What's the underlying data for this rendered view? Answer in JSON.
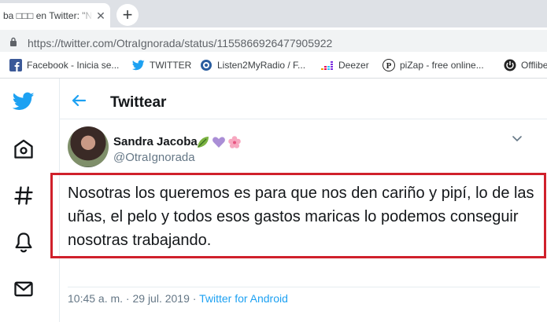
{
  "browser": {
    "tab": {
      "title": "ba □□□ en Twitter: \"N"
    },
    "url": "https://twitter.com/OtraIgnorada/status/1155866926477905922",
    "bookmarks": [
      {
        "label": "Facebook - Inicia se...",
        "icon": "facebook-icon"
      },
      {
        "label": "TWITTER",
        "icon": "twitter-icon"
      },
      {
        "label": "Listen2MyRadio / F...",
        "icon": "radio-icon"
      },
      {
        "label": "Deezer",
        "icon": "deezer-icon"
      },
      {
        "label": "piZap - free online...",
        "icon": "pizap-icon"
      },
      {
        "label": "Offlibe",
        "icon": "power-icon"
      }
    ]
  },
  "twitter": {
    "header_title": "Twittear",
    "author": {
      "name": "Sandra Jacoba",
      "handle": "@OtraIgnorada"
    },
    "tweet_text": "Nosotras los queremos es para que nos den cariño y pipí, lo de las uñas, el pelo y todos esos gastos maricas lo podemos conseguir nosotras trabajando.",
    "timestamp": "10:45 a. m. · 29 jul. 2019 · ",
    "source": "Twitter for Android"
  },
  "colors": {
    "twitter_blue": "#1da1f2",
    "highlight_red": "#d0202b",
    "text_primary": "#14171a",
    "text_secondary": "#657786"
  }
}
